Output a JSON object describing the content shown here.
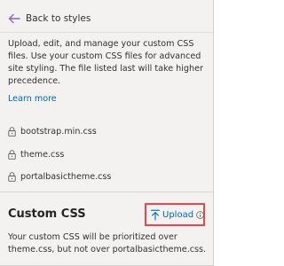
{
  "nav": {
    "back_label": "Back to styles"
  },
  "intro": {
    "description": "Upload, edit, and manage your custom CSS files. Use your custom CSS files for advanced site styling. The file listed last will take higher precedence.",
    "learn_more": "Learn more"
  },
  "files": [
    {
      "name": "bootstrap.min.css",
      "icon": "lock-icon"
    },
    {
      "name": "theme.css",
      "icon": "lock-icon"
    },
    {
      "name": "portalbasictheme.css",
      "icon": "lock-icon"
    }
  ],
  "custom_css": {
    "title": "Custom CSS",
    "upload_label": "Upload",
    "upload_icon": "upload-icon",
    "info_icon": "info-icon",
    "note": "Your custom CSS will be prioritized over theme.css, but not over portalbasictheme.css."
  },
  "colors": {
    "link": "#0067b8",
    "back_arrow": "#605e5c",
    "highlight_border": "#e8474f",
    "panel_background": "#f3f2f1"
  }
}
